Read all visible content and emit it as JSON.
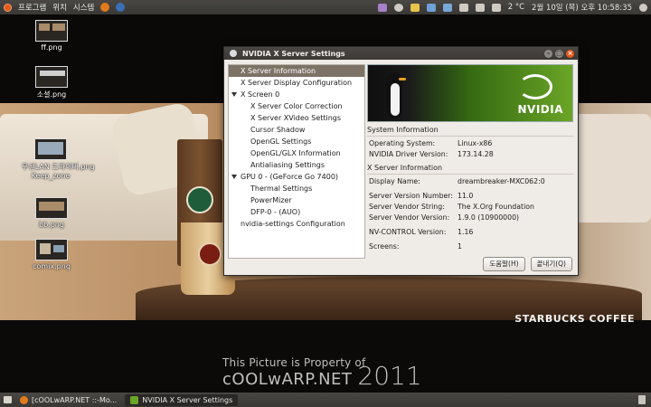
{
  "top_panel": {
    "menus": [
      "프로그램",
      "위치",
      "시스템"
    ],
    "weather": "2 °C",
    "datetime": "2월 10일 (목) 오후 10:58:35"
  },
  "desktop_icons": [
    {
      "label": "ff.png"
    },
    {
      "label": "소셜.png"
    },
    {
      "label": "무선LAN 드라이버.png\nKeep_zone"
    },
    {
      "label": "bb.png"
    },
    {
      "label": "comix.png"
    }
  ],
  "wallpaper": {
    "brand": "STARBUCKS COFFEE",
    "credit_line": "This Picture is Property of",
    "credit_site": "cOOLwARP.NET",
    "credit_year": "2011"
  },
  "window": {
    "title": "NVIDIA X Server Settings",
    "tree": [
      {
        "label": "X Server Information",
        "level": 0,
        "selected": true
      },
      {
        "label": "X Server Display Configuration",
        "level": 0
      },
      {
        "label": "X Screen 0",
        "level": 0,
        "expanded": true
      },
      {
        "label": "X Server Color Correction",
        "level": 1
      },
      {
        "label": "X Server XVideo Settings",
        "level": 1
      },
      {
        "label": "Cursor Shadow",
        "level": 1
      },
      {
        "label": "OpenGL Settings",
        "level": 1
      },
      {
        "label": "OpenGL/GLX Information",
        "level": 1
      },
      {
        "label": "Antialiasing Settings",
        "level": 1
      },
      {
        "label": "GPU 0 - (GeForce Go 7400)",
        "level": 0,
        "expanded": true
      },
      {
        "label": "Thermal Settings",
        "level": 1
      },
      {
        "label": "PowerMizer",
        "level": 1
      },
      {
        "label": "DFP-0 - (AUO)",
        "level": 1
      },
      {
        "label": "nvidia-settings Configuration",
        "level": 0
      }
    ],
    "banner_text": "NVIDIA",
    "system_info": {
      "title": "System Information",
      "rows": [
        {
          "key": "Operating System:",
          "value": "Linux-x86"
        },
        {
          "key": "NVIDIA Driver Version:",
          "value": "173.14.28"
        }
      ]
    },
    "xserver_info": {
      "title": "X Server Information",
      "rows": [
        {
          "key": "Display Name:",
          "value": "dreambreaker-MXC062:0"
        },
        {
          "key": "",
          "value": ""
        },
        {
          "key": "Server Version Number:",
          "value": "11.0"
        },
        {
          "key": "Server Vendor String:",
          "value": "The X.Org Foundation"
        },
        {
          "key": "Server Vendor Version:",
          "value": "1.9.0 (10900000)"
        },
        {
          "key": "",
          "value": ""
        },
        {
          "key": "NV-CONTROL Version:",
          "value": "1.16"
        },
        {
          "key": "",
          "value": ""
        },
        {
          "key": "Screens:",
          "value": "1"
        }
      ]
    },
    "buttons": {
      "help": "도움말(H)",
      "quit": "끝내기(Q)"
    }
  },
  "taskbar": {
    "items": [
      {
        "label": "[cOOLwARP.NET ::-Mo...",
        "active": false
      },
      {
        "label": "NVIDIA X Server Settings",
        "active": true
      }
    ]
  }
}
